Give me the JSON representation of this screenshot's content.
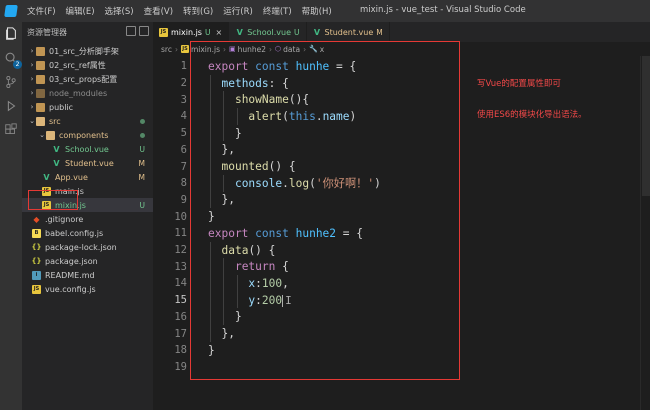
{
  "window": {
    "title": "mixin.js - vue_test - Visual Studio Code",
    "menu": [
      "文件(F)",
      "编辑(E)",
      "选择(S)",
      "查看(V)",
      "转到(G)",
      "运行(R)",
      "终端(T)",
      "帮助(H)"
    ]
  },
  "activity_bar": {
    "icons": [
      "files-icon",
      "search-icon",
      "source-control-icon",
      "run-debug-icon",
      "extensions-icon"
    ],
    "badge": "2"
  },
  "explorer": {
    "title": "资源管理器",
    "items": [
      {
        "label": "01_src_分析脚手架",
        "type": "folder",
        "status": ""
      },
      {
        "label": "02_src_ref属性",
        "type": "folder",
        "status": ""
      },
      {
        "label": "03_src_props配置",
        "type": "folder",
        "status": ""
      },
      {
        "label": "node_modules",
        "type": "folder",
        "status": ""
      },
      {
        "label": "public",
        "type": "folder",
        "status": ""
      },
      {
        "label": "src",
        "type": "folder-open",
        "status": "dot"
      },
      {
        "label": "components",
        "type": "folder-open",
        "status": "dot"
      },
      {
        "label": "School.vue",
        "type": "vue",
        "status": "U"
      },
      {
        "label": "Student.vue",
        "type": "vue",
        "status": "M"
      },
      {
        "label": "App.vue",
        "type": "vue",
        "status": "M"
      },
      {
        "label": "main.js",
        "type": "js",
        "status": ""
      },
      {
        "label": "mixin.js",
        "type": "js",
        "status": "U"
      },
      {
        "label": ".gitignore",
        "type": "git",
        "status": ""
      },
      {
        "label": "babel.config.js",
        "type": "babel",
        "status": ""
      },
      {
        "label": "package-lock.json",
        "type": "json",
        "status": ""
      },
      {
        "label": "package.json",
        "type": "json",
        "status": ""
      },
      {
        "label": "README.md",
        "type": "md",
        "status": ""
      },
      {
        "label": "vue.config.js",
        "type": "js",
        "status": ""
      }
    ]
  },
  "tabs": [
    {
      "label": "mixin.js",
      "status": "U",
      "icon": "JS",
      "active": true,
      "close": "×"
    },
    {
      "label": "School.vue",
      "status": "U",
      "icon": "V",
      "active": false,
      "close": ""
    },
    {
      "label": "Student.vue",
      "status": "M",
      "icon": "V",
      "active": false,
      "close": ""
    }
  ],
  "breadcrumb": [
    "src",
    "mixin.js",
    "hunhe2",
    "data",
    "x"
  ],
  "editor": {
    "lines": [
      {
        "n": "1",
        "tokens": [
          [
            "kw",
            "export"
          ],
          [
            "pun",
            " "
          ],
          [
            "kwb",
            "const"
          ],
          [
            "pun",
            " "
          ],
          [
            "id",
            "hunhe"
          ],
          [
            "pun",
            " = {"
          ]
        ]
      },
      {
        "n": "2",
        "tokens": [
          [
            "pun",
            "  "
          ],
          [
            "prop",
            "methods"
          ],
          [
            "pun",
            ": {"
          ]
        ]
      },
      {
        "n": "3",
        "tokens": [
          [
            "pun",
            "    "
          ],
          [
            "fn",
            "showName"
          ],
          [
            "pun",
            "(){"
          ]
        ]
      },
      {
        "n": "4",
        "tokens": [
          [
            "pun",
            "      "
          ],
          [
            "fn",
            "alert"
          ],
          [
            "pun",
            "("
          ],
          [
            "kwb",
            "this"
          ],
          [
            "pun",
            "."
          ],
          [
            "prop",
            "name"
          ],
          [
            "pun",
            ")"
          ]
        ]
      },
      {
        "n": "5",
        "tokens": [
          [
            "pun",
            "    }"
          ]
        ]
      },
      {
        "n": "6",
        "tokens": [
          [
            "pun",
            "  },"
          ]
        ]
      },
      {
        "n": "7",
        "tokens": [
          [
            "pun",
            "  "
          ],
          [
            "fn",
            "mounted"
          ],
          [
            "pun",
            "() {"
          ]
        ]
      },
      {
        "n": "8",
        "tokens": [
          [
            "pun",
            "    "
          ],
          [
            "prop",
            "console"
          ],
          [
            "pun",
            "."
          ],
          [
            "fn",
            "log"
          ],
          [
            "pun",
            "("
          ],
          [
            "str",
            "'你好啊！'"
          ],
          [
            "pun",
            ")"
          ]
        ]
      },
      {
        "n": "9",
        "tokens": [
          [
            "pun",
            "  },"
          ]
        ]
      },
      {
        "n": "10",
        "tokens": [
          [
            "pun",
            "}"
          ]
        ]
      },
      {
        "n": "11",
        "tokens": [
          [
            "kw",
            "export"
          ],
          [
            "pun",
            " "
          ],
          [
            "kwb",
            "const"
          ],
          [
            "pun",
            " "
          ],
          [
            "id",
            "hunhe2"
          ],
          [
            "pun",
            " = {"
          ]
        ]
      },
      {
        "n": "12",
        "tokens": [
          [
            "pun",
            "  "
          ],
          [
            "fn",
            "data"
          ],
          [
            "pun",
            "() {"
          ]
        ]
      },
      {
        "n": "13",
        "tokens": [
          [
            "pun",
            "    "
          ],
          [
            "kw",
            "return"
          ],
          [
            "pun",
            " {"
          ]
        ]
      },
      {
        "n": "14",
        "tokens": [
          [
            "pun",
            "      "
          ],
          [
            "prop",
            "x"
          ],
          [
            "pun",
            ":"
          ],
          [
            "num",
            "100"
          ],
          [
            "pun",
            ","
          ]
        ]
      },
      {
        "n": "15",
        "tokens": [
          [
            "pun",
            "      "
          ],
          [
            "prop",
            "y"
          ],
          [
            "pun",
            ":"
          ],
          [
            "num",
            "200"
          ]
        ]
      },
      {
        "n": "16",
        "tokens": [
          [
            "pun",
            "    }"
          ]
        ]
      },
      {
        "n": "17",
        "tokens": [
          [
            "pun",
            "  },"
          ]
        ]
      },
      {
        "n": "18",
        "tokens": [
          [
            "pun",
            "}"
          ]
        ]
      },
      {
        "n": "19",
        "tokens": []
      }
    ],
    "active_line": "15"
  },
  "annotations": [
    "写Vue的配置属性即可",
    "使用ES6的模块化导出语法。"
  ],
  "colors": {
    "highlight_box": "#e53935",
    "annotation_text": "#f04848",
    "modified": "#e2c08d",
    "untracked": "#73c991"
  }
}
